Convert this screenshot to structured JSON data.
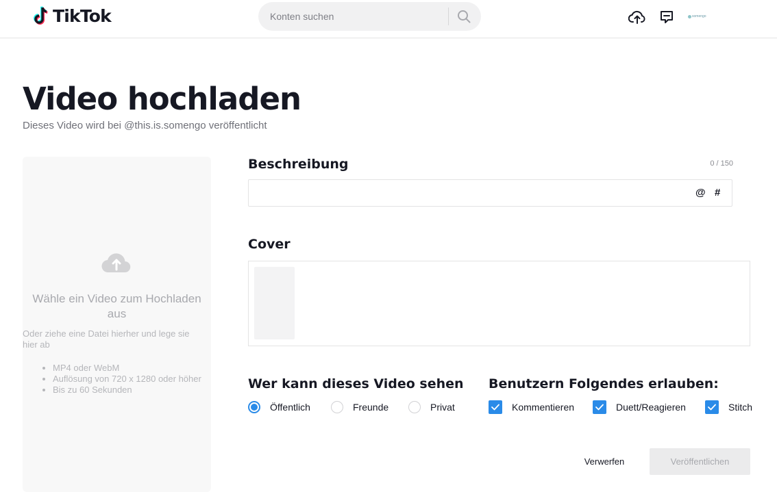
{
  "header": {
    "logo_text": "TikTok",
    "search_placeholder": "Konten suchen",
    "avatar_text": "somengo",
    "icons": [
      "upload-cloud-icon",
      "inbox-icon",
      "search-icon"
    ]
  },
  "page": {
    "title": "Video hochladen",
    "subtitle": "Dieses Video wird bei @this.is.somengo veröffentlicht"
  },
  "dropzone": {
    "title": "Wähle ein Video zum Hochladen aus",
    "hint": "Oder ziehe eine Datei hierher und lege sie hier ab",
    "requirements": [
      "MP4 oder WebM",
      "Auflösung von 720 x 1280 oder höher",
      "Bis zu 60 Sekunden"
    ]
  },
  "description": {
    "label": "Beschreibung",
    "char_count": "0 / 150",
    "value": "",
    "mention_symbol": "@",
    "hashtag_symbol": "#"
  },
  "cover": {
    "label": "Cover"
  },
  "visibility": {
    "label": "Wer kann dieses Video sehen",
    "options": [
      {
        "label": "Öffentlich",
        "checked": true
      },
      {
        "label": "Freunde",
        "checked": false
      },
      {
        "label": "Privat",
        "checked": false
      }
    ]
  },
  "permissions": {
    "label": "Benutzern Folgendes erlauben:",
    "options": [
      {
        "label": "Kommentieren",
        "checked": true
      },
      {
        "label": "Duett/Reagieren",
        "checked": true
      },
      {
        "label": "Stitch",
        "checked": true
      }
    ]
  },
  "actions": {
    "discard_label": "Verwerfen",
    "publish_label": "Veröffentlichen"
  },
  "colors": {
    "accent": "#2a8be8",
    "publish_disabled_bg": "#ebebec",
    "dropzone_bg": "#f8f8f8"
  }
}
